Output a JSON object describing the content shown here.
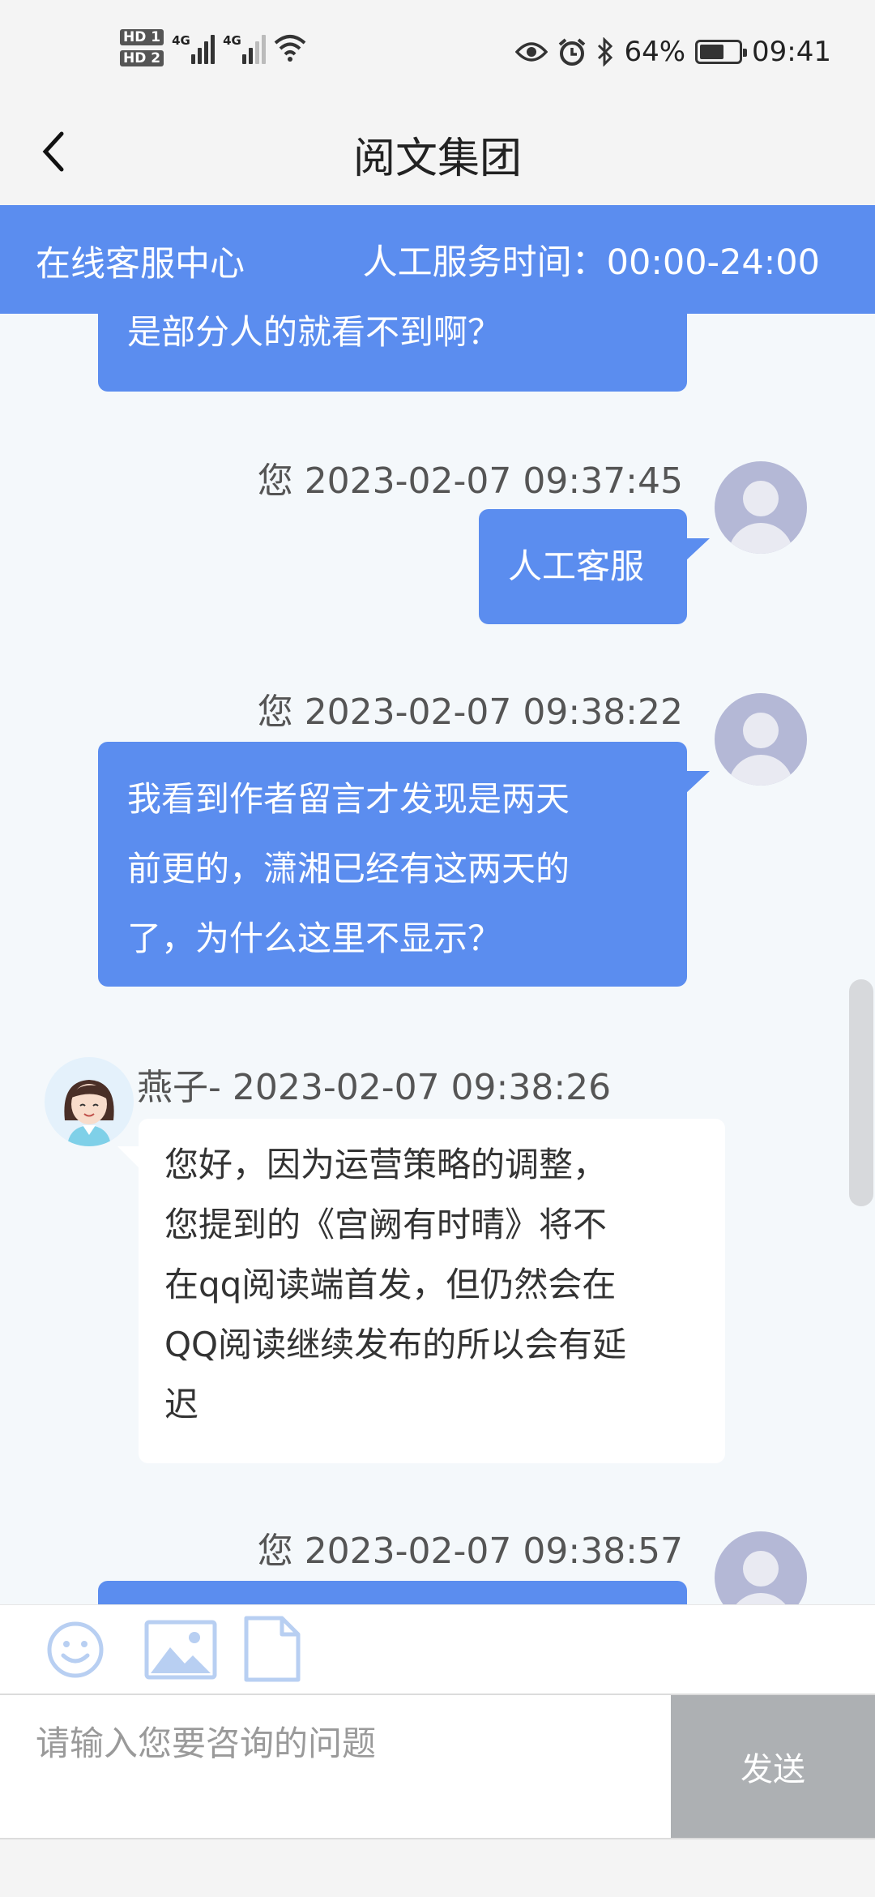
{
  "status_bar": {
    "sim1": "HD 1",
    "sim2": "HD 2",
    "net1": "4G",
    "net2": "4G",
    "battery_percent": "64%",
    "battery_level": 0.64,
    "time": "09:41",
    "icons": [
      "eye-icon",
      "alarm-icon",
      "bluetooth-icon",
      "wifi-icon",
      "battery-icon"
    ]
  },
  "nav": {
    "title": "阅文集团"
  },
  "banner": {
    "left": "在线客服中心",
    "right": "人工服务时间：00:00-24:00"
  },
  "messages": [
    {
      "sender": "user",
      "text": "是部分人的就看不到啊？",
      "partial": true
    },
    {
      "sender": "user",
      "meta": "您 2023-02-07 09:37:45",
      "text": "人工客服"
    },
    {
      "sender": "user",
      "meta": "您 2023-02-07 09:38:22",
      "lines": [
        "我看到作者留言才发现是两天",
        "前更的，潇湘已经有这两天的",
        "了，为什么这里不显示？"
      ]
    },
    {
      "sender": "agent",
      "meta": "燕子- 2023-02-07 09:38:26",
      "lines": [
        "您好，因为运营策略的调整，",
        "您提到的《宫阙有时晴》将不",
        "在qq阅读端首发，但仍然会在",
        "QQ阅读继续发布的所以会有延",
        "迟"
      ]
    },
    {
      "sender": "user",
      "meta": "您 2023-02-07 09:38:57",
      "text": ""
    }
  ],
  "input": {
    "placeholder": "请输入您要咨询的问题",
    "send_label": "发送"
  },
  "colors": {
    "accent": "#5b8def",
    "send_disabled": "#adb0b3",
    "background": "#f4f8fb"
  }
}
